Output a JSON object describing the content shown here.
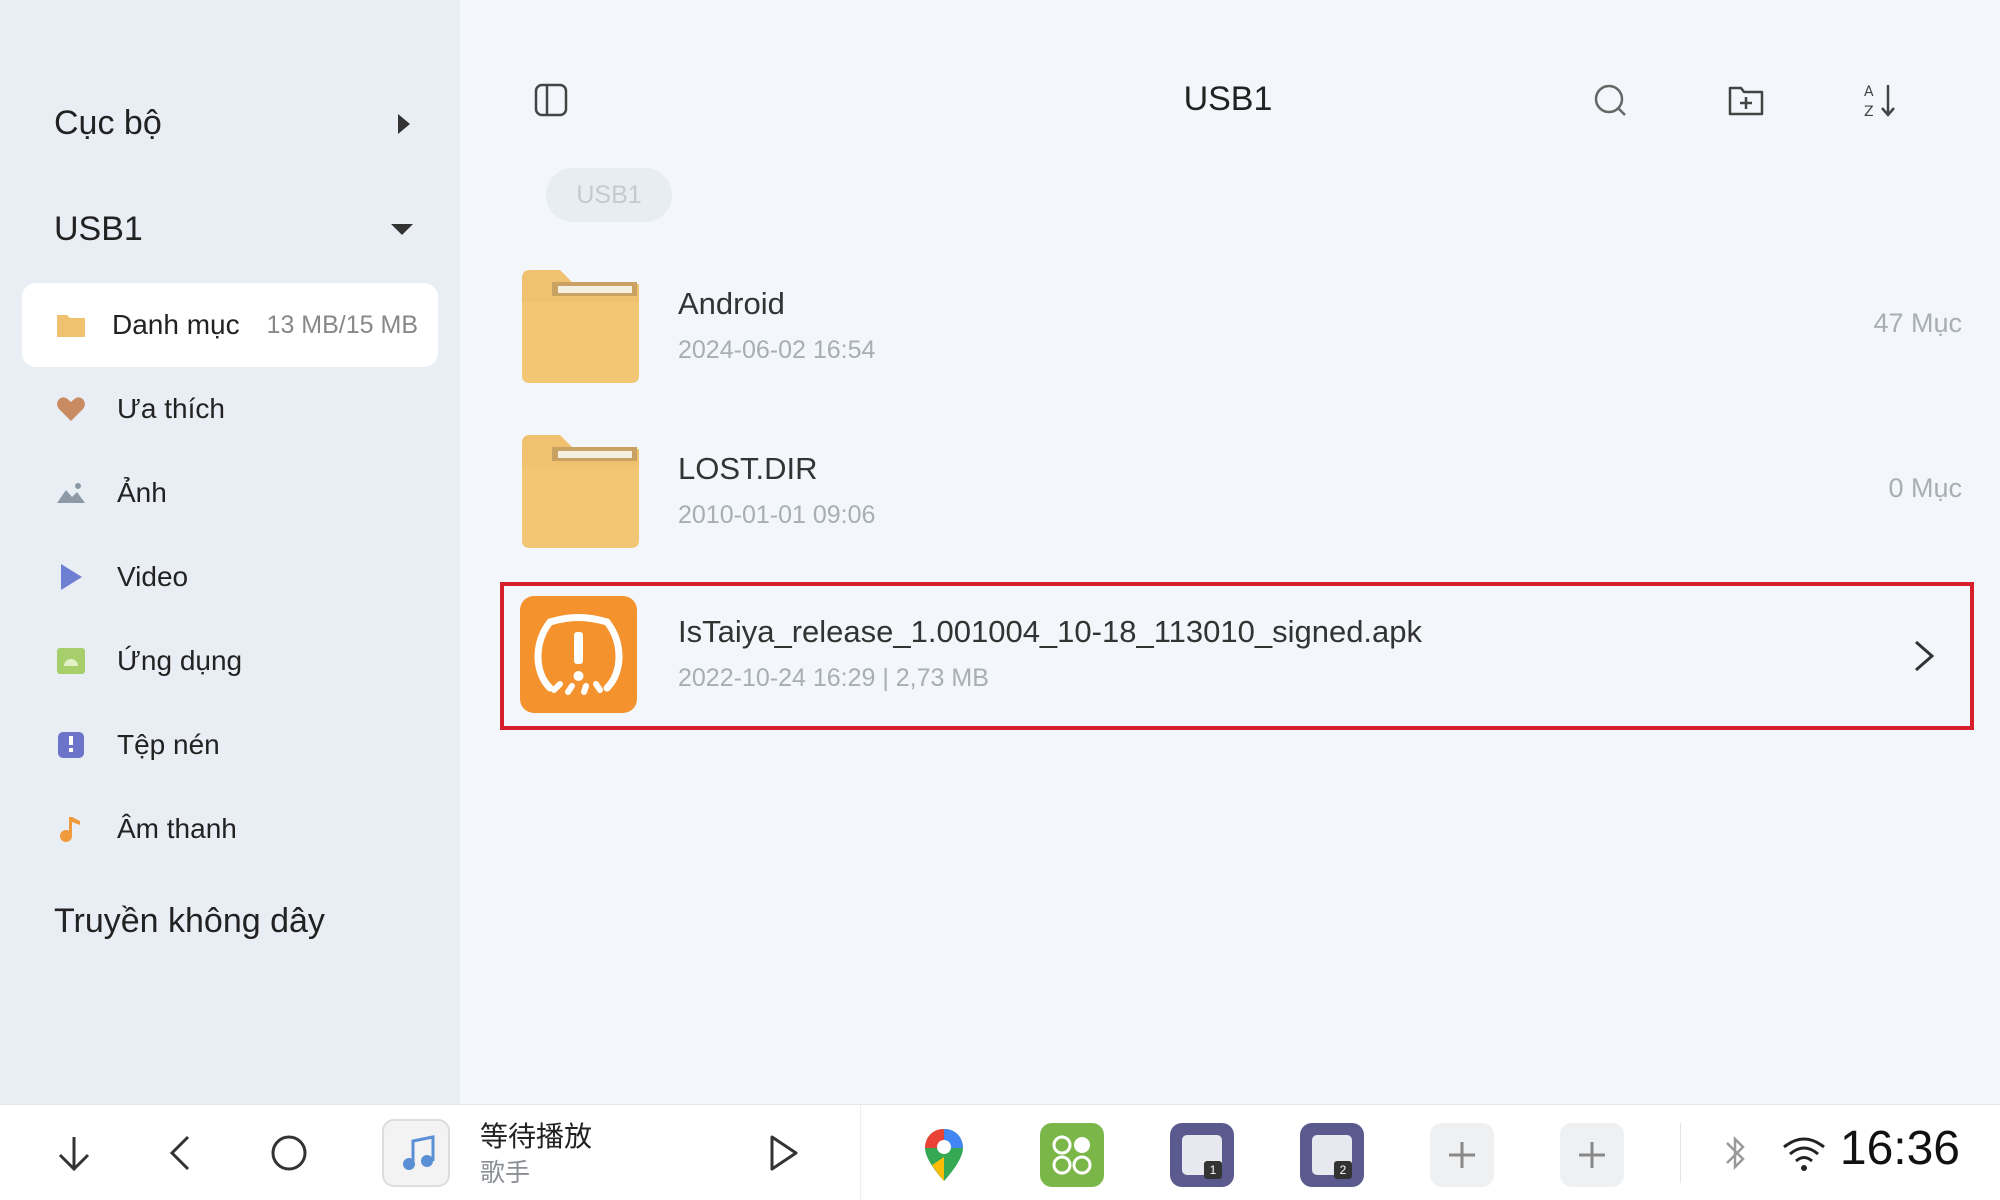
{
  "sidebar": {
    "sections": [
      {
        "label": "Cục bộ"
      },
      {
        "label": "USB1"
      },
      {
        "label": "Truyền không dây"
      }
    ],
    "items": [
      {
        "label": "Danh mục",
        "meta": "13 MB/15 MB",
        "icon": "folder-icon"
      },
      {
        "label": "Ưa thích",
        "icon": "heart-icon"
      },
      {
        "label": "Ảnh",
        "icon": "image-icon"
      },
      {
        "label": "Video",
        "icon": "play-icon"
      },
      {
        "label": "Ứng dụng",
        "icon": "android-icon"
      },
      {
        "label": "Tệp nén",
        "icon": "archive-icon"
      },
      {
        "label": "Âm thanh",
        "icon": "music-note-icon"
      }
    ]
  },
  "main": {
    "title": "USB1",
    "breadcrumb": "USB1",
    "files": [
      {
        "name": "Android",
        "meta": "2024-06-02 16:54",
        "count": "47 Mục",
        "type": "folder"
      },
      {
        "name": "LOST.DIR",
        "meta": "2010-01-01 09:06",
        "count": "0 Mục",
        "type": "folder"
      },
      {
        "name": "IsTaiya_release_1.001004_10-18_113010_signed.apk",
        "meta": "2022-10-24 16:29 | 2,73 MB",
        "type": "apk"
      }
    ]
  },
  "bottombar": {
    "music_title": "等待播放",
    "music_artist": "歌手",
    "clock": "16:36"
  },
  "colors": {
    "highlight": "#d6202c",
    "folder": "#f0c26f",
    "apk": "#f4922e",
    "sidebar_bg": "#e9eef5"
  }
}
